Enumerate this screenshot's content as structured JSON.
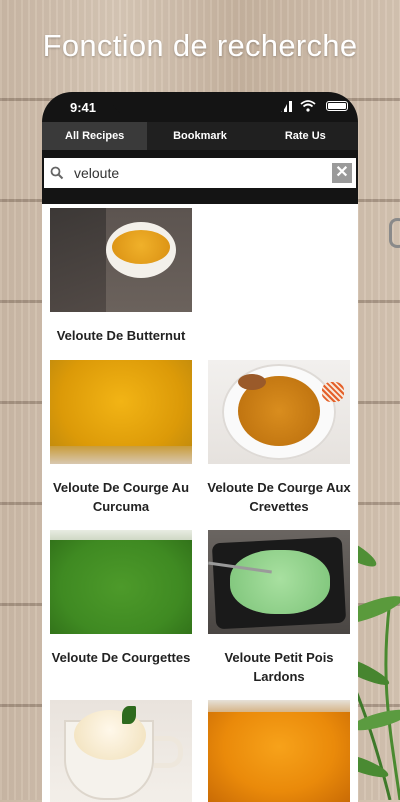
{
  "headline": "Fonction de recherche",
  "status": {
    "time": "9:41"
  },
  "tabs": [
    {
      "label": "All Recipes",
      "active": true
    },
    {
      "label": "Bookmark",
      "active": false
    },
    {
      "label": "Rate Us",
      "active": false
    }
  ],
  "search": {
    "value": "veloute",
    "clear_label": "✕"
  },
  "recipes": [
    {
      "title": "Veloute De Butternut"
    },
    {
      "title": "Veloute De Courge Au Curcuma"
    },
    {
      "title": "Veloute De Courge Aux Crevettes"
    },
    {
      "title": "Veloute De Courgettes"
    },
    {
      "title": "Veloute Petit Pois Lardons"
    },
    {
      "title": ""
    },
    {
      "title": ""
    }
  ],
  "colors": {
    "tab_bar": "#202020",
    "active_tab": "#3a3a3a",
    "phone_frame": "#141414"
  }
}
